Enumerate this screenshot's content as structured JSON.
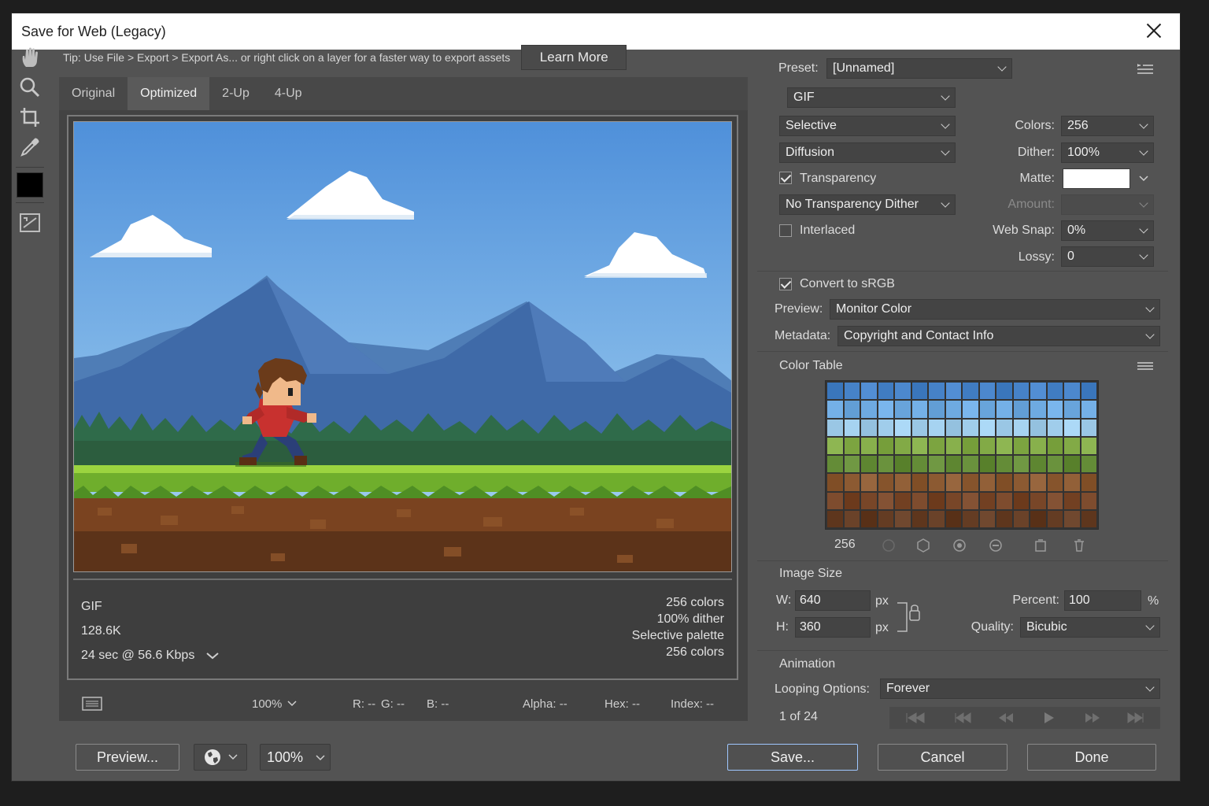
{
  "window": {
    "title": "Save for Web (Legacy)"
  },
  "tip": {
    "text": "Tip: Use File > Export > Export As... or right click on a layer for a faster way to export assets",
    "learn_more": "Learn More"
  },
  "tabs": [
    "Original",
    "Optimized",
    "2-Up",
    "4-Up"
  ],
  "image_info": {
    "format": "GIF",
    "size": "128.6K",
    "download": "24 sec @ 56.6 Kbps",
    "colors": "256 colors",
    "dither": "100% dither",
    "palette": "Selective palette",
    "colors2": "256 colors"
  },
  "statusbar": {
    "zoom": "100%",
    "r": "R: --",
    "g": "G: --",
    "b": "B: --",
    "alpha": "Alpha: --",
    "hex": "Hex: --",
    "index": "Index: --"
  },
  "settings": {
    "preset_label": "Preset:",
    "preset_value": "[Unnamed]",
    "format": "GIF",
    "reduction": "Selective",
    "dither_algo": "Diffusion",
    "transparency_label": "Transparency",
    "transparency_dither": "No Transparency Dither",
    "interlaced_label": "Interlaced",
    "colors_label": "Colors:",
    "colors_value": "256",
    "dither_label": "Dither:",
    "dither_value": "100%",
    "matte_label": "Matte:",
    "amount_label": "Amount:",
    "websnap_label": "Web Snap:",
    "websnap_value": "0%",
    "lossy_label": "Lossy:",
    "lossy_value": "0",
    "convert_srgb_label": "Convert to sRGB",
    "preview_label": "Preview:",
    "preview_value": "Monitor Color",
    "metadata_label": "Metadata:",
    "metadata_value": "Copyright and Contact Info"
  },
  "color_table": {
    "title": "Color Table",
    "count": "256"
  },
  "image_size": {
    "title": "Image Size",
    "w_label": "W:",
    "w_value": "640",
    "h_label": "H:",
    "h_value": "360",
    "unit": "px",
    "percent_label": "Percent:",
    "percent_value": "100",
    "percent_unit": "%",
    "quality_label": "Quality:",
    "quality_value": "Bicubic"
  },
  "animation": {
    "title": "Animation",
    "looping_label": "Looping Options:",
    "looping_value": "Forever",
    "frame_counter": "1 of 24"
  },
  "buttons": {
    "preview": "Preview...",
    "zoom": "100%",
    "save": "Save...",
    "cancel": "Cancel",
    "done": "Done"
  },
  "colors": {
    "accent": "#9fc7ff",
    "dialog_bg": "#535353",
    "panel_bg": "#434343"
  }
}
